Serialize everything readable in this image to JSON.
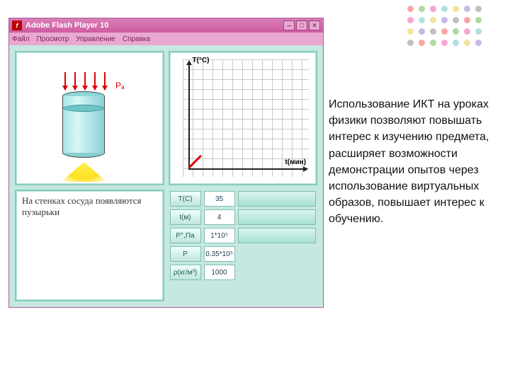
{
  "dots_colors": [
    "#f7a6a6",
    "#b0d9a0",
    "#f7a6d0",
    "#b0e0e0",
    "#f2e39c",
    "#c8b8e8",
    "#c0c0c0"
  ],
  "window": {
    "title": "Adobe Flash Player 10",
    "menu": [
      "Файл",
      "Просмотр",
      "Управление",
      "Справка"
    ]
  },
  "experiment": {
    "pressure_label": "Pₐ"
  },
  "graph": {
    "y_axis": "T(°C)",
    "x_axis": "t(мин)"
  },
  "controls": [
    {
      "label": "T(C)",
      "value": "35"
    },
    {
      "label": "t(м)",
      "value": "4"
    },
    {
      "label": "P°,Па",
      "value": "1*10⁵"
    },
    {
      "label": "P",
      "value": "0.35*10⁵"
    },
    {
      "label": "ρ(кг/м³)",
      "value": "1000"
    }
  ],
  "caption": "На стенках сосуда появляются пузырьки",
  "sidetext": "   Использование ИКТ на уроках физики позволяют повышать интерес к изучению предмета, расширяет возможности демонстрации опытов через использование виртуальных образов, повышает интерес к обучению."
}
